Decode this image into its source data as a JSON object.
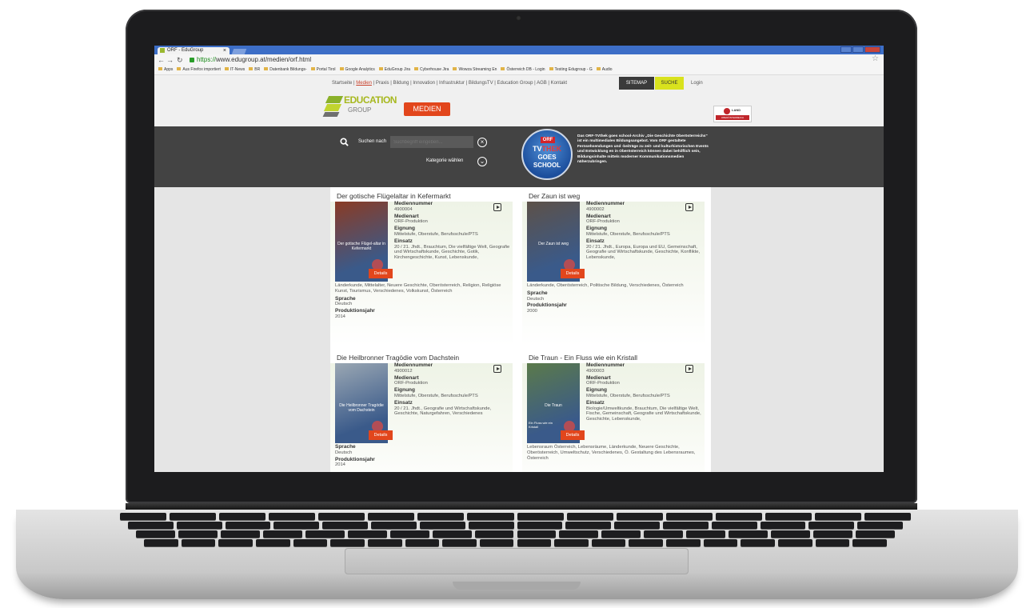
{
  "browser": {
    "tab_title": "ORF - EduGroup",
    "tab_close": "×",
    "url_scheme": "https://",
    "url_rest": "www.edugroup.at/medien/orf.html",
    "bookmarks": [
      "Apps",
      "Aus Firefox importiert",
      "IT-News",
      "BR",
      "Datenbank Bildungs-",
      "Portal Tirol",
      "Google Analytics",
      "EduGroup Jira",
      "Cyberhouse Jira",
      "Wowza Streaming En",
      "Österreich DB - Login",
      "Testing Edugroup - G",
      "Audio"
    ]
  },
  "header": {
    "links": [
      "Startseite",
      "Medien",
      "Praxis",
      "Bildung",
      "Innovation",
      "Infrastruktur",
      "BildungsTV",
      "Education Group",
      "AGB",
      "Kontakt"
    ],
    "sitemap": "SITEMAP",
    "suche": "SUCHE",
    "login": "Login",
    "logo_main": "EDUCATION",
    "logo_sub": "GROUP",
    "medien_badge": "MEDIEN",
    "land_name": "LAND",
    "land_region": "OBERÖSTERREICH"
  },
  "search": {
    "label": "Suchen nach",
    "placeholder": "Suchbegriff eingeben...",
    "category_label": "Kategorie wählen"
  },
  "orf_promo": {
    "orf": "ORF",
    "tv": "TV",
    "thek": "THEK",
    "goes": "GOES",
    "school": "SCHOOL",
    "text": "Das ORF-TVthek goes school-Archiv „Die Geschichte Oberösterreichs\" ist ein multimediales Bildungsangebot. Vom ORF gestaltete Fernsehsendungen und -beiträge zu zeit- und kulturhistorischen Events und Entwicklung en in Oberösterreich können dabei behilflich sein, Bildungsinhalte mittels moderner Kommunikationsmedien näherzubringen."
  },
  "labels": {
    "mediennummer": "Mediennummer",
    "medienart": "Medienart",
    "eignung": "Eignung",
    "einsatz": "Einsatz",
    "sprache": "Sprache",
    "produktionsjahr": "Produktionsjahr",
    "details": "Details"
  },
  "cards": [
    {
      "title": "Der gotische Flügelaltar in Kefermarkt",
      "thumb_caption": "Der gotische Flügel-altar in Kefermarkt",
      "mediennummer": "4900004",
      "medienart": "ORF-Produktion",
      "eignung": "Mittelstufe, Oberstufe, Berufsschule/PTS",
      "einsatz_a": "20 / 21. Jhdt., Brauchtum, Die vielfältige Welt, Geografie und Wirtschaftskunde, Geschichte, Gotik, Kirchengeschichte, Kunst, Lebenskunde,",
      "einsatz_b": "Länderkunde, Mittelalter, Neuere Geschichte, Oberösterreich, Religion, Religiöse Kunst, Tourismus, Verschiedenes, Volkskunst, Österreich",
      "sprache": "Deutsch",
      "produktionsjahr": "2014",
      "thumb_color": "#8a3b24"
    },
    {
      "title": "Der Zaun ist weg",
      "thumb_caption": "Der Zaun ist weg",
      "mediennummer": "4900002",
      "medienart": "ORF-Produktion",
      "eignung": "Mittelstufe, Oberstufe, Berufsschule/PTS",
      "einsatz_a": "20 / 21. Jhdt., Europa, Europa und EU, Gemeinschaft, Geografie und Wirtschaftskunde, Geschichte, Konflikte, Lebenskunde,",
      "einsatz_b": "Länderkunde, Oberösterreich, Politische Bildung, Verschiedenes, Österreich",
      "sprache": "Deutsch",
      "produktionsjahr": "2000",
      "thumb_color": "#5d5148"
    },
    {
      "title": "Die Heilbronner Tragödie vom Dachstein",
      "thumb_caption": "Die Heilbronner Tragödie vom Dachstein",
      "mediennummer": "4900012",
      "medienart": "ORF-Produktion",
      "eignung": "Mittelstufe, Oberstufe, Berufsschule/PTS",
      "einsatz_a": "20 / 21. Jhdt., Geografie und Wirtschaftskunde, Geschichte, Naturgefahren, Verschiedenes",
      "einsatz_b": "",
      "sprache": "Deutsch",
      "produktionsjahr": "2014",
      "thumb_color": "#9aa7b3"
    },
    {
      "title": "Die Traun - Ein Fluss wie ein Kristall",
      "thumb_caption": "Die Traun",
      "thumb_sub": "Ein Fluss wie ein Kristall",
      "mediennummer": "4900003",
      "medienart": "ORF-Produktion",
      "eignung": "Mittelstufe, Oberstufe, Berufsschule/PTS",
      "einsatz_a": "Biologie/Umweltkunde, Brauchtum, Die vielfältige Welt, Fische, Gemeinschaft, Geografie und Wirtschaftskunde, Geschichte, Lebenskunde,",
      "einsatz_b": "Lebensraum Österreich, Lebensräume, Länderkunde, Neuere Geschichte, Oberösterreich, Umweltschutz, Verschiedenes, Ö. Gestaltung des Lebensraumes, Österreich",
      "sprache": "",
      "produktionsjahr": "",
      "thumb_color": "#5b7a4a"
    }
  ]
}
